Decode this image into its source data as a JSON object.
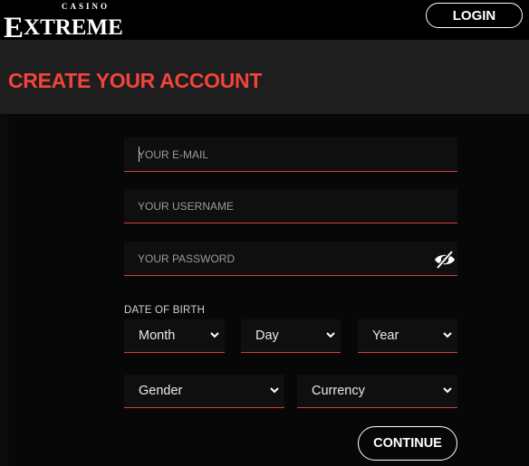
{
  "header": {
    "logo_small": "CASINO",
    "logo_big_first": "E",
    "logo_big_rest": "XTREME",
    "login_label": "LOGIN"
  },
  "page_title": "CREATE YOUR ACCOUNT",
  "form": {
    "email_placeholder": "YOUR E-MAIL",
    "username_placeholder": "YOUR USERNAME",
    "password_placeholder": "YOUR PASSWORD",
    "dob_label": "DATE OF BIRTH",
    "month_label": "Month",
    "day_label": "Day",
    "year_label": "Year",
    "gender_label": "Gender",
    "currency_label": "Currency",
    "continue_label": "CONTINUE"
  },
  "icons": {
    "password_toggle": "eye-slash-icon",
    "dropdown": "chevron-down-icon"
  },
  "colors": {
    "accent": "#f1443c",
    "field_underline": "#d43f3a"
  }
}
